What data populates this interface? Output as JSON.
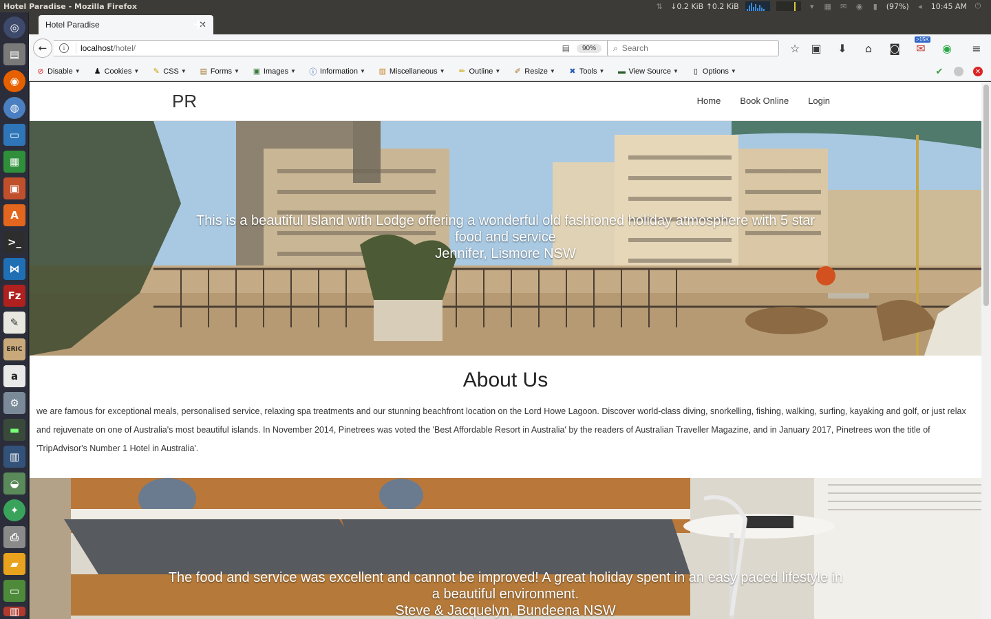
{
  "window": {
    "title": "Hotel Paradise - Mozilla Firefox"
  },
  "system_tray": {
    "net_speed": "↓0.2 KiB ↑0.2 KiB",
    "battery": "(97%)",
    "clock": "10:45 AM"
  },
  "browser": {
    "tab_title": "Hotel Paradise",
    "url_host": "localhost",
    "url_path": "/hotel/",
    "zoom": "90%",
    "search_placeholder": "Search",
    "mail_badge": ">15K"
  },
  "dev_toolbar": {
    "items": [
      "Disable",
      "Cookies",
      "CSS",
      "Forms",
      "Images",
      "Information",
      "Miscellaneous",
      "Outline",
      "Resize",
      "Tools",
      "View Source",
      "Options"
    ]
  },
  "site": {
    "brand": "PR",
    "menu": [
      "Home",
      "Book Online",
      "Login"
    ],
    "hero1": {
      "quote": "This is a beautiful Island with Lodge offering a wonderful old fashioned holiday atmosphere with 5 star food and service",
      "author": "Jennifer, Lismore NSW"
    },
    "about": {
      "title": "About Us",
      "text": "we are famous for exceptional meals, personalised service, relaxing spa treatments and our stunning beachfront location on the Lord Howe Lagoon. Discover world-class diving, snorkelling, fishing, walking, surfing, kayaking and golf, or just relax and rejuvenate on one of Australia's most beautiful islands. In November 2014, Pinetrees was voted the 'Best Affordable Resort in Australia' by the readers of Australian Traveller Magazine, and in January 2017, Pinetrees won the title of 'TripAdvisor's Number 1 Hotel in Australia'."
    },
    "hero2": {
      "quote": "The food and service was excellent and cannot be improved! A great holiday spent in an easy paced lifestyle in a beautiful environment.",
      "author": "Steve & Jacquelyn, Bundeena NSW"
    }
  },
  "colors": {
    "launcher_bg": "#2b2e3a",
    "topbar_bg": "#3c3b37",
    "chrome_bg": "#f5f6f7",
    "page_bg": "#ffffff"
  }
}
